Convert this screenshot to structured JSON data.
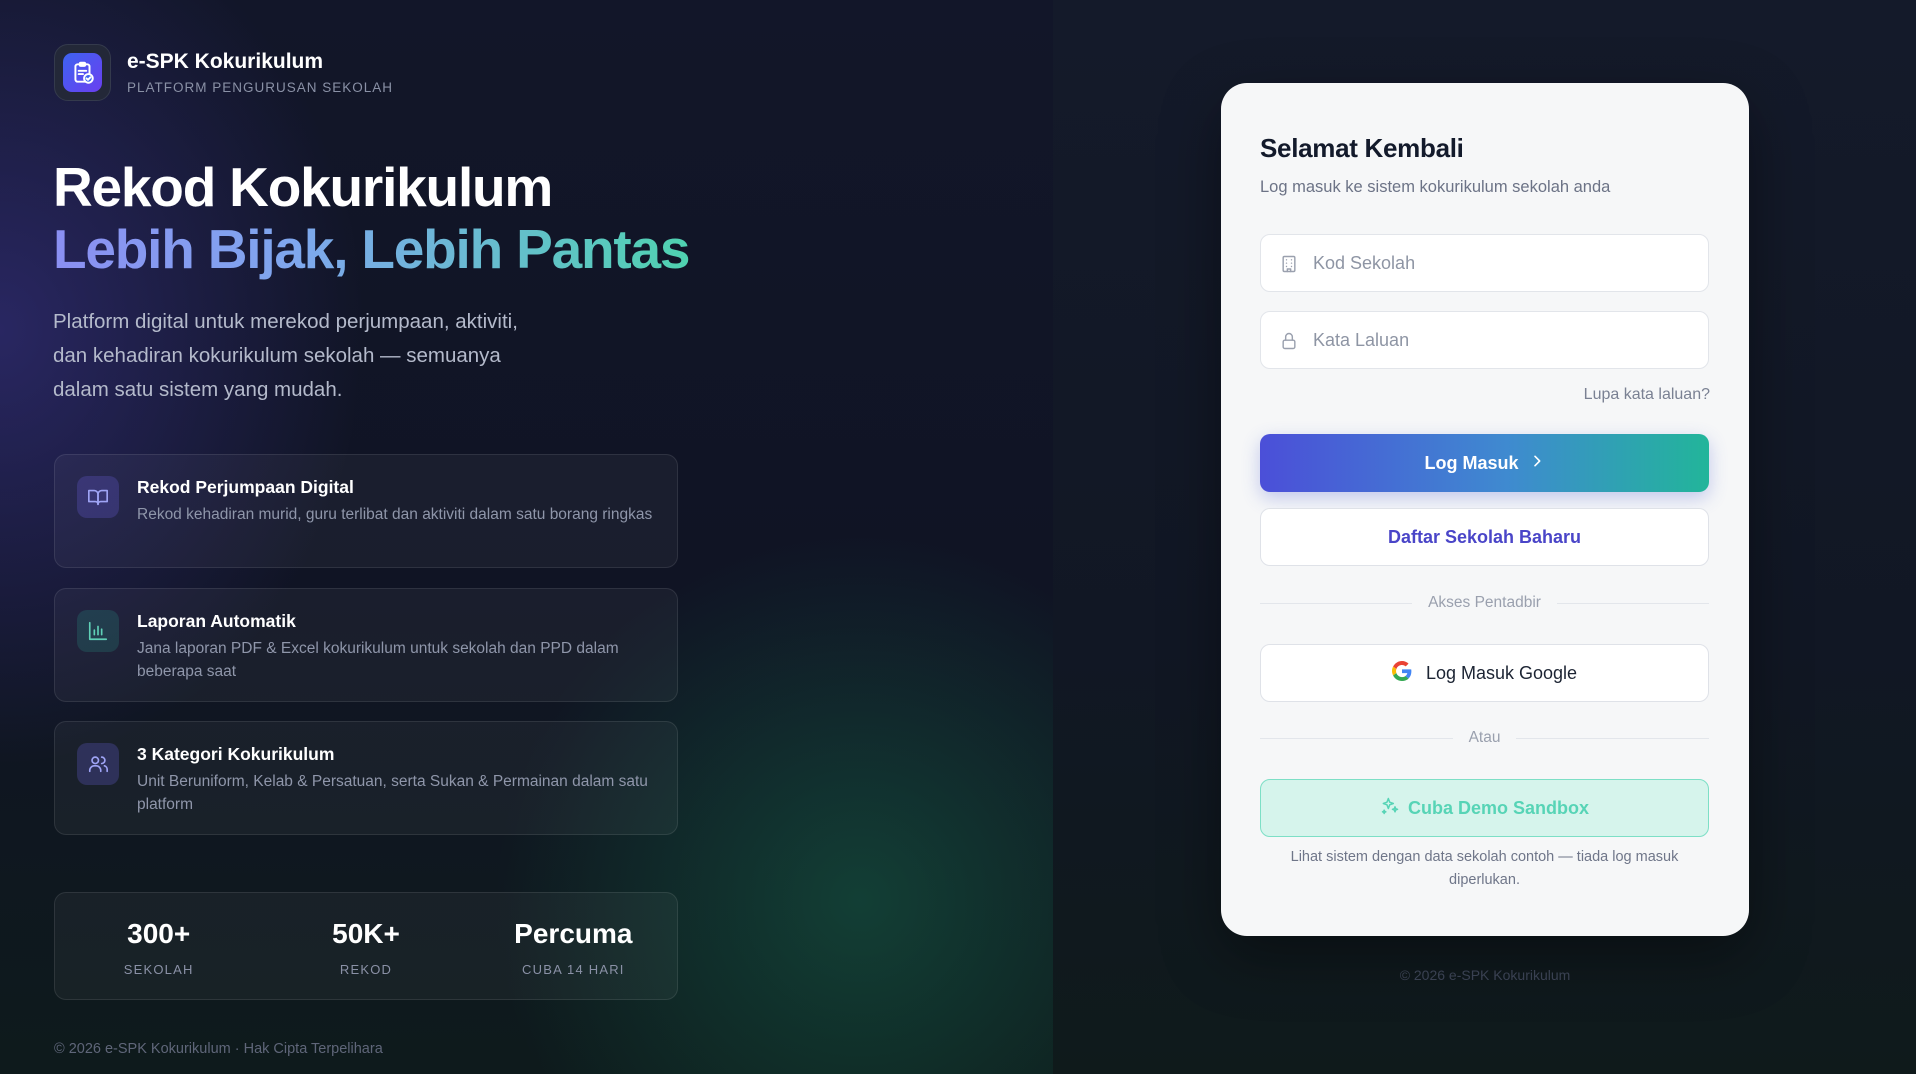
{
  "brand": {
    "title": "e-SPK Kokurikulum",
    "subtitle": "PLATFORM PENGURUSAN SEKOLAH",
    "logo_icon": "clipboard-check-icon"
  },
  "hero": {
    "line1": "Rekod Kokurikulum",
    "line2": "Lebih Bijak, Lebih Pantas",
    "description": "Platform digital untuk merekod perjumpaan, aktiviti, dan kehadiran kokurikulum sekolah — semuanya dalam satu sistem yang mudah."
  },
  "features": [
    {
      "icon": "book-open-icon",
      "title": "Rekod Perjumpaan Digital",
      "description": "Rekod kehadiran murid, guru terlibat dan aktiviti dalam satu borang ringkas"
    },
    {
      "icon": "bar-chart-icon",
      "title": "Laporan Automatik",
      "description": "Jana laporan PDF & Excel kokurikulum untuk sekolah dan PPD dalam beberapa saat"
    },
    {
      "icon": "users-icon",
      "title": "3 Kategori Kokurikulum",
      "description": "Unit Beruniform, Kelab & Persatuan, serta Sukan & Permainan dalam satu platform"
    }
  ],
  "stats": [
    {
      "value": "300+",
      "label": "SEKOLAH"
    },
    {
      "value": "50K+",
      "label": "REKOD"
    },
    {
      "value": "Percuma",
      "label": "CUBA 14 HARI"
    }
  ],
  "footer_left": "© 2026 e-SPK Kokurikulum · Hak Cipta Terpelihara",
  "login": {
    "title": "Selamat Kembali",
    "subtitle": "Log masuk ke sistem kokurikulum sekolah anda",
    "school_code_placeholder": "Kod Sekolah",
    "password_placeholder": "Kata Laluan",
    "forgot_label": "Lupa kata laluan?",
    "login_button": "Log Masuk",
    "register_button": "Daftar Sekolah Baharu",
    "admin_divider": "Akses Pentadbir",
    "google_button": "Log Masuk Google",
    "or_divider": "Atau",
    "demo_button": "Cuba Demo Sandbox",
    "demo_note": "Lihat sistem dengan data sekolah contoh — tiada log masuk diperlukan."
  },
  "footer_right": "© 2026 e-SPK Kokurikulum",
  "colors": {
    "accent_indigo": "#4b4fd8",
    "accent_teal": "#22b59a",
    "card_background": "#f6f7f8",
    "page_background": "#0f1420"
  }
}
